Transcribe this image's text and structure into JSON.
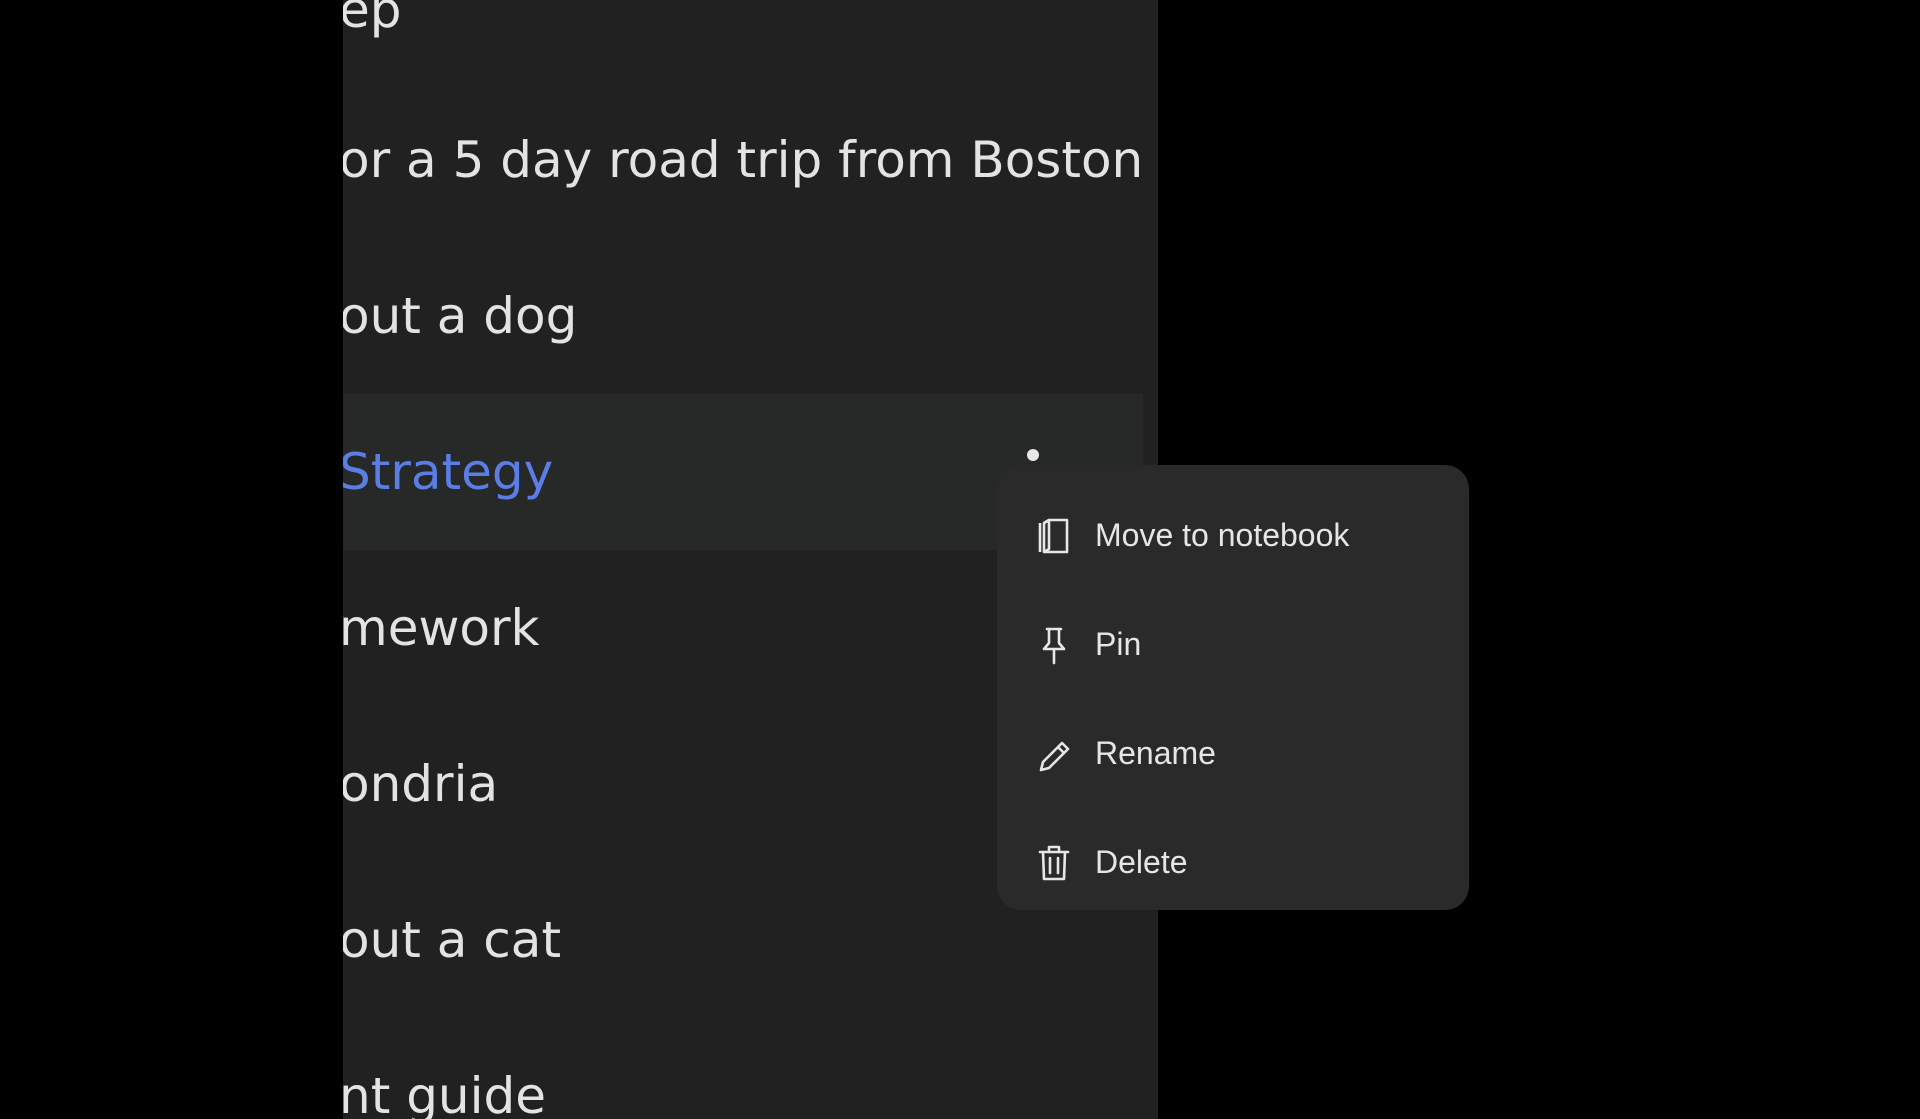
{
  "chat_list": {
    "items": [
      {
        "label": "ep",
        "selected": false
      },
      {
        "label": "or a 5 day road trip from Boston",
        "selected": false
      },
      {
        "label": "out a dog",
        "selected": false
      },
      {
        "label": "Strategy",
        "selected": true
      },
      {
        "label": "mework",
        "selected": false
      },
      {
        "label": "ondria",
        "selected": false
      },
      {
        "label": "out a cat",
        "selected": false
      },
      {
        "label": "nt guide",
        "selected": false
      }
    ]
  },
  "context_menu": {
    "items": [
      {
        "label": "Move to notebook",
        "icon": "notebook-icon"
      },
      {
        "label": "Pin",
        "icon": "pin-icon"
      },
      {
        "label": "Rename",
        "icon": "pencil-icon"
      },
      {
        "label": "Delete",
        "icon": "trash-icon"
      }
    ]
  },
  "colors": {
    "background": "#000000",
    "panel": "#212121",
    "selected_row": "#272828",
    "selected_text": "#5a7ee6",
    "menu": "#2a2a2a",
    "text": "#e3e3e3"
  }
}
